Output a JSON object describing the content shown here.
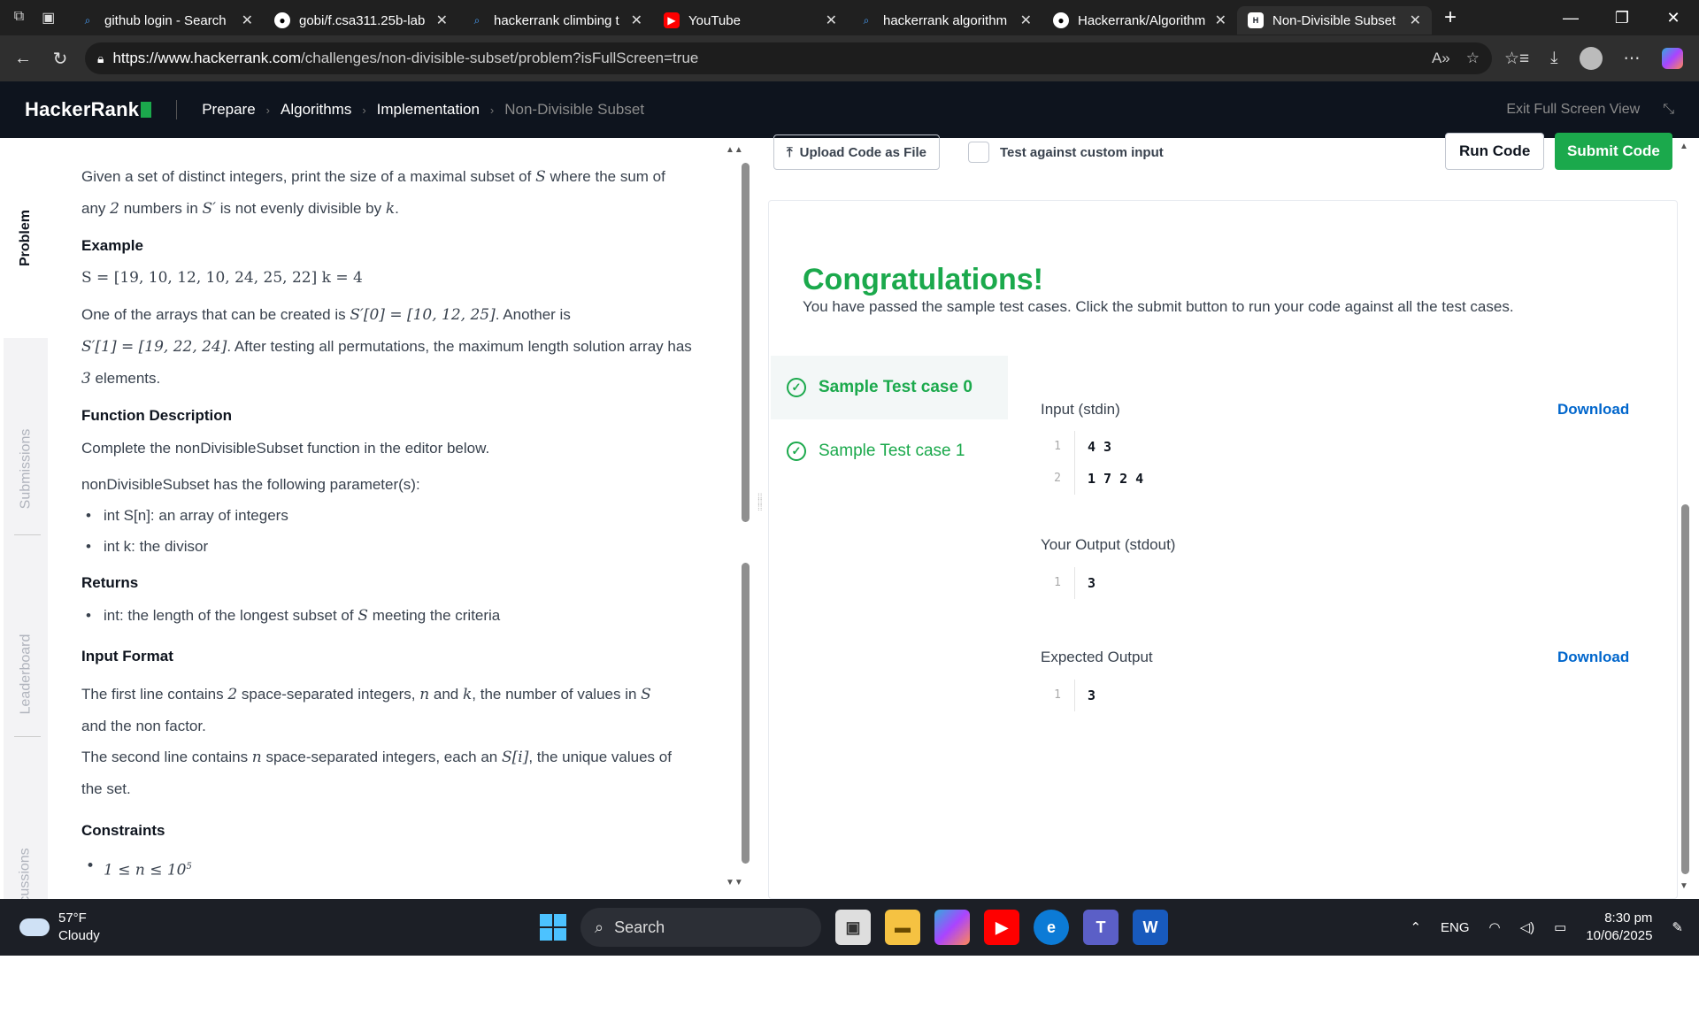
{
  "browser": {
    "tabs": [
      {
        "title": "github login - Search",
        "icon": "search-icon",
        "active": false
      },
      {
        "title": "gobi/f.csa311.25b-lab",
        "icon": "github-icon",
        "active": false
      },
      {
        "title": "hackerrank climbing t",
        "icon": "search-icon",
        "active": false
      },
      {
        "title": "YouTube",
        "icon": "youtube-icon",
        "active": false
      },
      {
        "title": "hackerrank algorithm",
        "icon": "search-icon",
        "active": false
      },
      {
        "title": "Hackerrank/Algorithm",
        "icon": "github-icon",
        "active": false
      },
      {
        "title": "Non-Divisible Subset",
        "icon": "hackerrank-icon",
        "active": true
      }
    ],
    "url_host": "https://www.hackerrank.com",
    "url_path": "/challenges/non-divisible-subset/problem?isFullScreen=true"
  },
  "header": {
    "logo": "HackerRank",
    "crumbs": [
      "Prepare",
      "Algorithms",
      "Implementation",
      "Non-Divisible Subset"
    ],
    "exit": "Exit Full Screen View"
  },
  "sidebar": {
    "tabs": [
      "Problem",
      "Submissions",
      "Leaderboard",
      "Discussions"
    ]
  },
  "problem": {
    "intro_a": "Given a set of distinct integers, print the size of a maximal subset of ",
    "intro_b": " where the sum of any ",
    "intro_c": " numbers in ",
    "intro_d": " is not evenly divisible by ",
    "example_h": "Example",
    "example_line": "S = [19, 10, 12, 10, 24, 25, 22]  k = 4",
    "ex_p1": "One of the arrays that can be created is ",
    "ex_m1": "S′[0] = [10, 12, 25]",
    "ex_p2": ". Another is",
    "ex_m2": "S′[1] = [19, 22, 24]",
    "ex_p3": ". After testing all permutations, the maximum length solution array has ",
    "ex_p4": " elements.",
    "func_h": "Function Description",
    "func_p": "Complete the nonDivisibleSubset function in the editor below.",
    "params_p": "nonDivisibleSubset has the following parameter(s):",
    "params": [
      "int S[n]: an array of integers",
      "int k: the divisor"
    ],
    "returns_h": "Returns",
    "returns_a": "int: the length of the longest subset of ",
    "returns_b": " meeting the criteria",
    "input_h": "Input Format",
    "in1a": "The first line contains ",
    "in1b": " space-separated integers, ",
    "in1c": " and ",
    "in1d": ", the number of values in ",
    "in1e": "and the non factor.",
    "in2a": "The second line contains ",
    "in2b": " space-separated integers, each an ",
    "in2c": ", the unique values of",
    "in2d": "the set.",
    "constraints_h": "Constraints",
    "constraint1": "1 ≤ n ≤ 10",
    "constraint1_exp": "5",
    "m_S": "S",
    "m_Sp": "S′",
    "m_k": "k",
    "m_n": "n",
    "m_two": "2",
    "m_three": "3",
    "m_Si": "S[i]"
  },
  "toolbar": {
    "upload": "Upload Code as File",
    "custom": "Test against custom input",
    "run": "Run Code",
    "submit": "Submit Code"
  },
  "result": {
    "title": "Congratulations!",
    "subtitle": "You have passed the sample test cases. Click the submit button to run your code against all the test cases.",
    "cases": [
      "Sample Test case 0",
      "Sample Test case 1"
    ],
    "input_label": "Input (stdin)",
    "download": "Download",
    "input_lines": [
      {
        "n": "1",
        "t": "4 3"
      },
      {
        "n": "2",
        "t": "1 7 2 4"
      }
    ],
    "output_label": "Your Output (stdout)",
    "output_lines": [
      {
        "n": "1",
        "t": "3"
      }
    ],
    "expected_label": "Expected Output",
    "expected_lines": [
      {
        "n": "1",
        "t": "3"
      }
    ]
  },
  "taskbar": {
    "temp": "57°F",
    "weather": "Cloudy",
    "search": "Search",
    "lang": "ENG",
    "time": "8:30 pm",
    "date": "10/06/2025"
  }
}
